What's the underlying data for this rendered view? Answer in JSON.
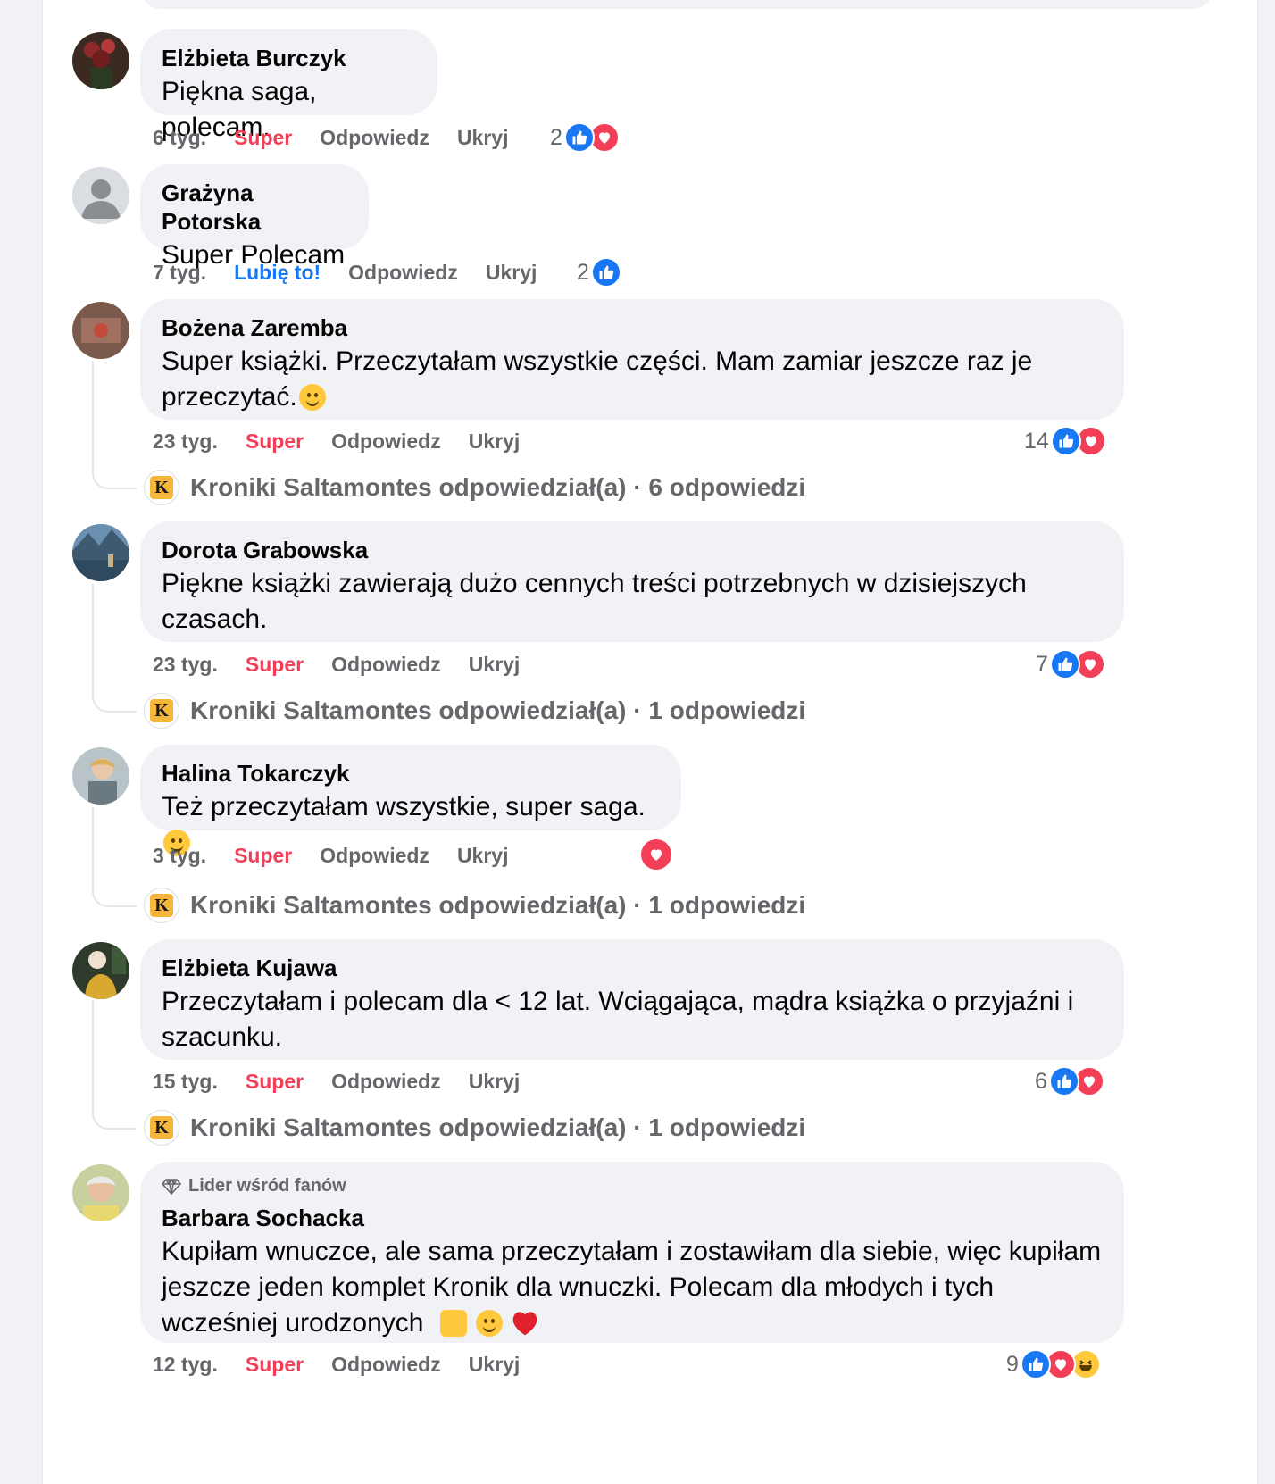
{
  "comments": [
    {
      "author": "Elżbieta Burczyk",
      "text": "Piękna saga, polecam.",
      "time": "6 tyg.",
      "reaction_label": "Super",
      "reply_label": "Odpowiedz",
      "hide_label": "Ukryj",
      "reaction_count": "2",
      "reactions": [
        "like",
        "love"
      ]
    },
    {
      "author": "Grażyna Potorska",
      "text": "Super Polecam",
      "time": "7 tyg.",
      "reaction_label": "Lubię to!",
      "reply_label": "Odpowiedz",
      "hide_label": "Ukryj",
      "reaction_count": "2",
      "reactions": [
        "like"
      ]
    },
    {
      "author": "Bożena Zaremba",
      "text": "Super książki. Przeczytałam wszystkie części. Mam zamiar jeszcze raz je przeczytać.",
      "time": "23 tyg.",
      "reaction_label": "Super",
      "reply_label": "Odpowiedz",
      "hide_label": "Ukryj",
      "reaction_count": "14",
      "reactions": [
        "like",
        "love"
      ],
      "replies": "Kroniki Saltamontes odpowiedział(a) · 6 odpowiedzi"
    },
    {
      "author": "Dorota Grabowska",
      "text": "Piękne książki zawierają dużo cennych treści potrzebnych w dzisiejszych czasach.",
      "time": "23 tyg.",
      "reaction_label": "Super",
      "reply_label": "Odpowiedz",
      "hide_label": "Ukryj",
      "reaction_count": "7",
      "reactions": [
        "like",
        "love"
      ],
      "replies": "Kroniki Saltamontes odpowiedział(a) · 1 odpowiedzi"
    },
    {
      "author": "Halina Tokarczyk",
      "text": "Też przeczytałam wszystkie, super saga.",
      "time": "3 tyg.",
      "reaction_label": "Super",
      "reply_label": "Odpowiedz",
      "hide_label": "Ukryj",
      "reactions": [
        "love"
      ],
      "replies": "Kroniki Saltamontes odpowiedział(a) · 1 odpowiedzi"
    },
    {
      "author": "Elżbieta Kujawa",
      "text": "Przeczytałam i polecam dla < 12 lat. Wciągająca, mądra książka o przyjaźni i szacunku.",
      "time": "15 tyg.",
      "reaction_label": "Super",
      "reply_label": "Odpowiedz",
      "hide_label": "Ukryj",
      "reaction_count": "6",
      "reactions": [
        "like",
        "love"
      ],
      "replies": "Kroniki Saltamontes odpowiedział(a) · 1 odpowiedzi"
    },
    {
      "badge": "Lider wśród fanów",
      "author": "Barbara Sochacka",
      "text": "Kupiłam wnuczce, ale sama przeczytałam i zostawiłam dla siebie, więc kupiłam jeszcze jeden komplet Kronik dla wnuczki. Polecam dla młodych i tych wcześniej urodzonych",
      "time": "12 tyg.",
      "reaction_label": "Super",
      "reply_label": "Odpowiedz",
      "hide_label": "Ukryj",
      "reaction_count": "9",
      "reactions": [
        "like",
        "love",
        "haha"
      ]
    }
  ],
  "colors": {
    "like": "#1877f2",
    "love": "#f33e58",
    "muted": "#65676b",
    "bubble": "#f0f2f5"
  }
}
